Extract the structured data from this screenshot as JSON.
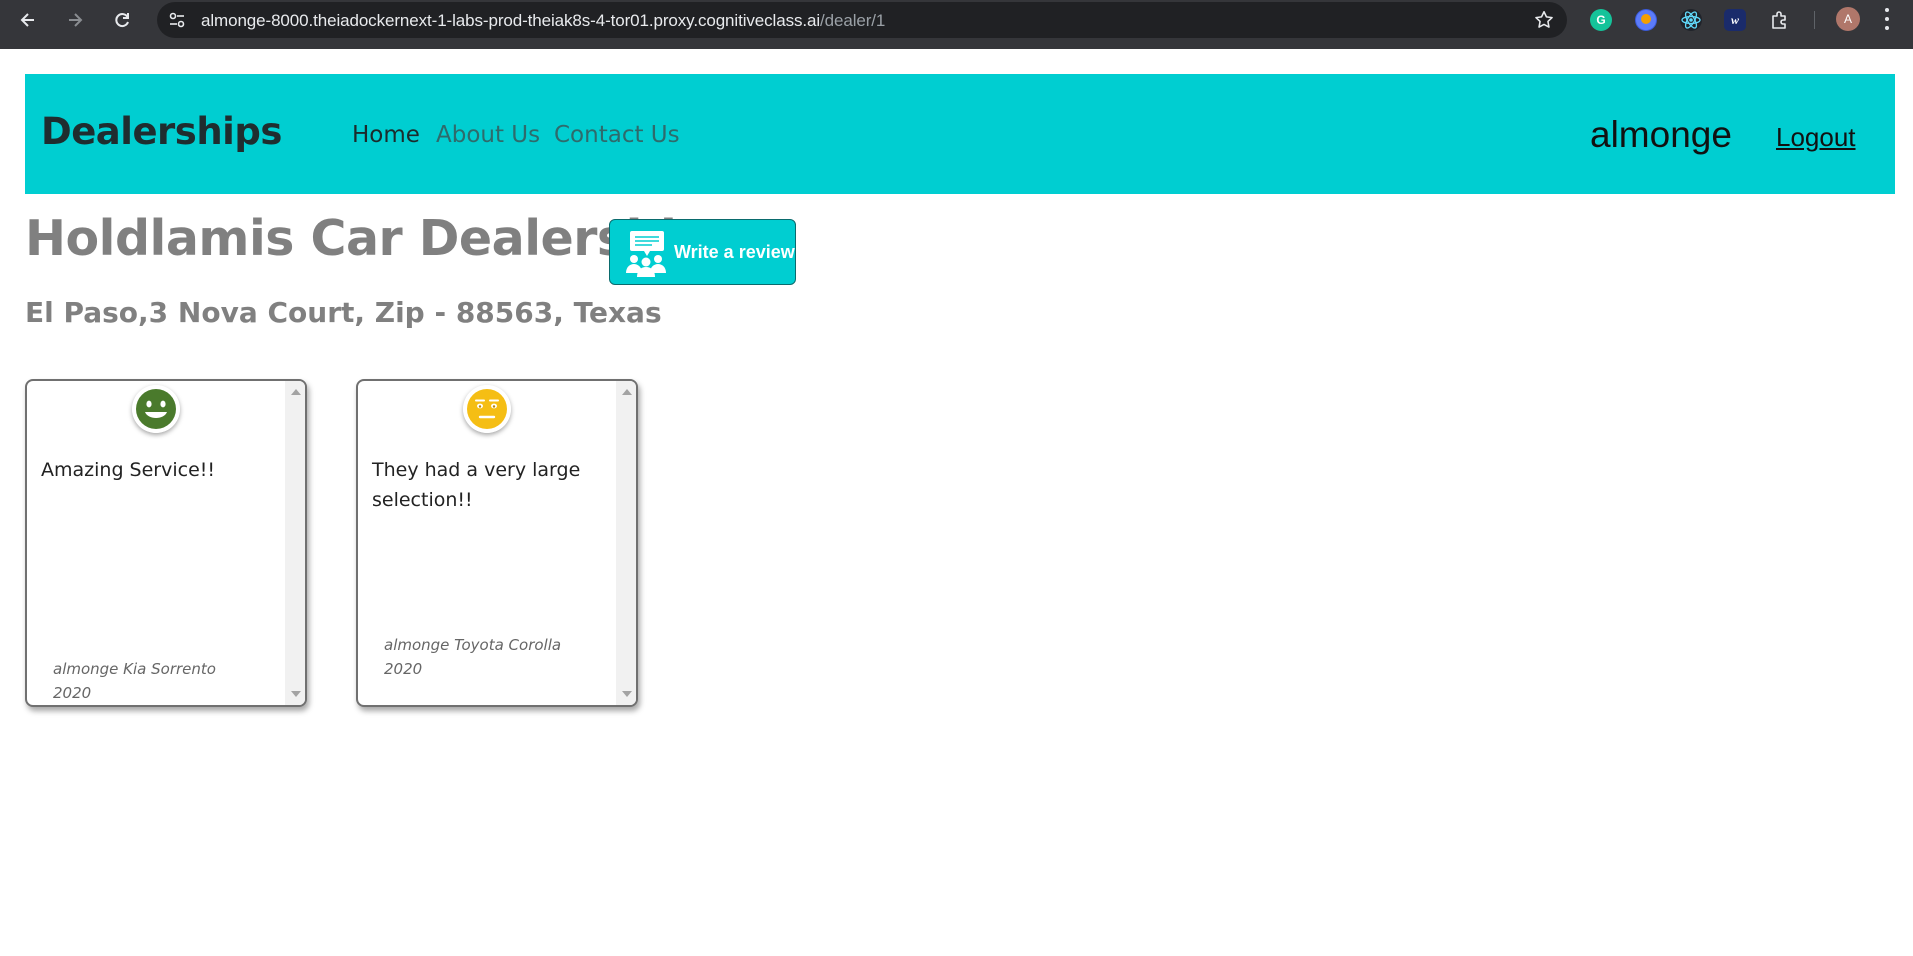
{
  "browser": {
    "url_host": "almonge-8000.theiadockernext-1-labs-prod-theiak8s-4-tor01.proxy.cognitiveclass.ai",
    "url_path": "/dealer/1",
    "avatar_initial": "A",
    "extensions": [
      "grammarly-icon",
      "extension-orange-icon",
      "react-devtools-icon",
      "wordtune-icon",
      "puzzle-extensions-icon"
    ]
  },
  "navbar": {
    "brand": "Dealerships",
    "links": [
      "Home",
      "About Us",
      "Contact Us"
    ],
    "active_link": "Home",
    "username": "almonge",
    "logout": "Logout",
    "background_color": "#00ced1"
  },
  "dealer": {
    "name": "Holdlamis Car Dealership",
    "address": "El Paso,3 Nova Court, Zip - 88563, Texas",
    "review_button_label": "Write a review"
  },
  "reviews": [
    {
      "sentiment_icon": "positive-face-icon",
      "text": "Amazing Service!!",
      "reviewer": "almonge Kia Sorrento 2020"
    },
    {
      "sentiment_icon": "neutral-face-icon",
      "text": "They had a very large selection!!",
      "reviewer": "almonge Toyota Corolla 2020"
    }
  ],
  "colors": {
    "positive": "#4a7a2c",
    "neutral": "#f5be14",
    "accent": "#00ced1",
    "heading_gray": "#808080"
  }
}
